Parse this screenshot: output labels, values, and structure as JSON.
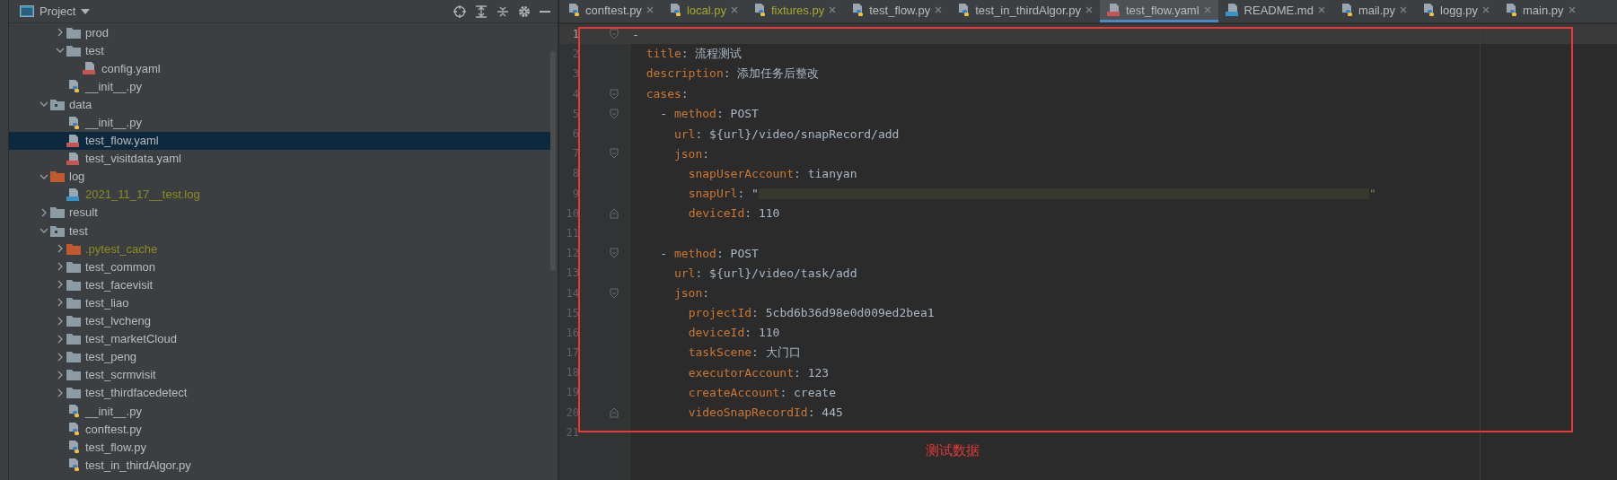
{
  "project_panel": {
    "title": "Project",
    "tree": [
      {
        "children": [
          {
            "name": "prod",
            "kind": "folder",
            "expanded": false,
            "selected": false,
            "ignored": false
          },
          {
            "name": "test",
            "kind": "folder",
            "expanded": true,
            "selected": false,
            "ignored": false,
            "children": [
              {
                "name": "config.yaml",
                "kind": "yaml",
                "selected": false,
                "ignored": false
              }
            ]
          },
          {
            "name": "__init__.py",
            "kind": "python",
            "selected": false,
            "ignored": false
          }
        ]
      },
      {
        "name": "data",
        "kind": "package",
        "expanded": true,
        "selected": false,
        "ignored": false,
        "children": [
          {
            "name": "__init__.py",
            "kind": "python",
            "selected": false,
            "ignored": false
          },
          {
            "name": "test_flow.yaml",
            "kind": "yaml",
            "selected": true,
            "ignored": false
          },
          {
            "name": "test_visitdata.yaml",
            "kind": "yaml",
            "selected": false,
            "ignored": false
          }
        ]
      },
      {
        "name": "log",
        "kind": "excluded",
        "expanded": true,
        "selected": false,
        "ignored": false,
        "children": [
          {
            "name": "2021_11_17__test.log",
            "kind": "log",
            "selected": false,
            "ignored": true
          }
        ]
      },
      {
        "name": "result",
        "kind": "folder",
        "expanded": false,
        "selected": false,
        "ignored": false
      },
      {
        "name": "test",
        "kind": "package",
        "expanded": true,
        "selected": false,
        "ignored": false,
        "children": [
          {
            "name": ".pytest_cache",
            "kind": "excluded",
            "expanded": false,
            "selected": false,
            "ignored": true
          },
          {
            "name": "test_common",
            "kind": "folder",
            "expanded": false,
            "selected": false,
            "ignored": false
          },
          {
            "name": "test_facevisit",
            "kind": "folder",
            "expanded": false,
            "selected": false,
            "ignored": false
          },
          {
            "name": "test_liao",
            "kind": "folder",
            "expanded": false,
            "selected": false,
            "ignored": false
          },
          {
            "name": "test_lvcheng",
            "kind": "folder",
            "expanded": false,
            "selected": false,
            "ignored": false
          },
          {
            "name": "test_marketCloud",
            "kind": "folder",
            "expanded": false,
            "selected": false,
            "ignored": false
          },
          {
            "name": "test_peng",
            "kind": "folder",
            "expanded": false,
            "selected": false,
            "ignored": false
          },
          {
            "name": "test_scrmvisit",
            "kind": "folder",
            "expanded": false,
            "selected": false,
            "ignored": false
          },
          {
            "name": "test_thirdfacedetect",
            "kind": "folder",
            "expanded": false,
            "selected": false,
            "ignored": false
          },
          {
            "name": "__init__.py",
            "kind": "python",
            "selected": false,
            "ignored": false
          },
          {
            "name": "conftest.py",
            "kind": "python",
            "selected": false,
            "ignored": false
          },
          {
            "name": "test_flow.py",
            "kind": "python",
            "selected": false,
            "ignored": false
          },
          {
            "name": "test_in_thirdAlgor.py",
            "kind": "python",
            "selected": false,
            "ignored": false
          }
        ]
      }
    ]
  },
  "tabs": [
    {
      "label": "conftest.py",
      "kind": "python",
      "selected": false,
      "ignored": false
    },
    {
      "label": "local.py",
      "kind": "python",
      "selected": false,
      "ignored": true
    },
    {
      "label": "fixtures.py",
      "kind": "python",
      "selected": false,
      "ignored": true
    },
    {
      "label": "test_flow.py",
      "kind": "python",
      "selected": false,
      "ignored": false
    },
    {
      "label": "test_in_thirdAlgor.py",
      "kind": "python",
      "selected": false,
      "ignored": false
    },
    {
      "label": "test_flow.yaml",
      "kind": "yaml",
      "selected": true,
      "ignored": false
    },
    {
      "label": "README.md",
      "kind": "markdown",
      "selected": false,
      "ignored": false
    },
    {
      "label": "mail.py",
      "kind": "python",
      "selected": false,
      "ignored": false
    },
    {
      "label": "logg.py",
      "kind": "python",
      "selected": false,
      "ignored": false
    },
    {
      "label": "main.py",
      "kind": "python",
      "selected": false,
      "ignored": false
    }
  ],
  "editor": {
    "lines": [
      {
        "number": "1",
        "kind": "code",
        "code": "-",
        "fold_start": true,
        "fold_end": false,
        "current": true
      },
      {
        "number": "2",
        "kind": "code",
        "code": "  title: 流程测试",
        "fold_start": false,
        "fold_end": false,
        "current": false
      },
      {
        "number": "3",
        "kind": "code",
        "code": "  description: 添加任务后整改",
        "fold_start": false,
        "fold_end": false,
        "current": false
      },
      {
        "number": "4",
        "kind": "code",
        "code": "  cases:",
        "fold_start": true,
        "fold_end": false,
        "current": false
      },
      {
        "number": "5",
        "kind": "code",
        "code": "    - method: POST",
        "fold_start": true,
        "fold_end": false,
        "current": false
      },
      {
        "number": "6",
        "kind": "code",
        "code": "      url: ${url}/video/snapRecord/add",
        "fold_start": false,
        "fold_end": false,
        "current": false
      },
      {
        "number": "7",
        "kind": "code",
        "code": "      json:",
        "fold_start": true,
        "fold_end": false,
        "current": false
      },
      {
        "number": "8",
        "kind": "code",
        "code": "        snapUserAccount: tianyan",
        "fold_start": false,
        "fold_end": false,
        "current": false
      },
      {
        "number": "9",
        "kind": "redacted",
        "code": "        snapUrl: \"",
        "tail": "\"",
        "fold_start": false,
        "fold_end": false,
        "current": false
      },
      {
        "number": "10",
        "kind": "code",
        "code": "        deviceId: 110",
        "fold_start": false,
        "fold_end": true,
        "current": false
      },
      {
        "number": "11",
        "kind": "blank",
        "fold_start": false,
        "fold_end": false,
        "current": false
      },
      {
        "number": "12",
        "kind": "code",
        "code": "    - method: POST",
        "fold_start": true,
        "fold_end": false,
        "current": false
      },
      {
        "number": "13",
        "kind": "code",
        "code": "      url: ${url}/video/task/add",
        "fold_start": false,
        "fold_end": false,
        "current": false
      },
      {
        "number": "14",
        "kind": "code",
        "code": "      json:",
        "fold_start": true,
        "fold_end": false,
        "current": false
      },
      {
        "number": "15",
        "kind": "code",
        "code": "        projectId: 5cbd6b36d98e0d009ed2bea1",
        "fold_start": false,
        "fold_end": false,
        "current": false
      },
      {
        "number": "16",
        "kind": "code",
        "code": "        deviceId: 110",
        "fold_start": false,
        "fold_end": false,
        "current": false
      },
      {
        "number": "17",
        "kind": "code",
        "code": "        taskScene: 大门口",
        "fold_start": false,
        "fold_end": false,
        "current": false
      },
      {
        "number": "18",
        "kind": "code",
        "code": "        executorAccount: 123",
        "fold_start": false,
        "fold_end": false,
        "current": false
      },
      {
        "number": "19",
        "kind": "code",
        "code": "        createAccount: create",
        "fold_start": false,
        "fold_end": false,
        "current": false
      },
      {
        "number": "20",
        "kind": "code",
        "code": "        videoSnapRecordId: 445",
        "fold_start": false,
        "fold_end": true,
        "current": false
      },
      {
        "number": "21",
        "kind": "blank",
        "fold_start": false,
        "fold_end": false,
        "current": false
      }
    ]
  },
  "annotation": {
    "caption": "测试数据"
  }
}
